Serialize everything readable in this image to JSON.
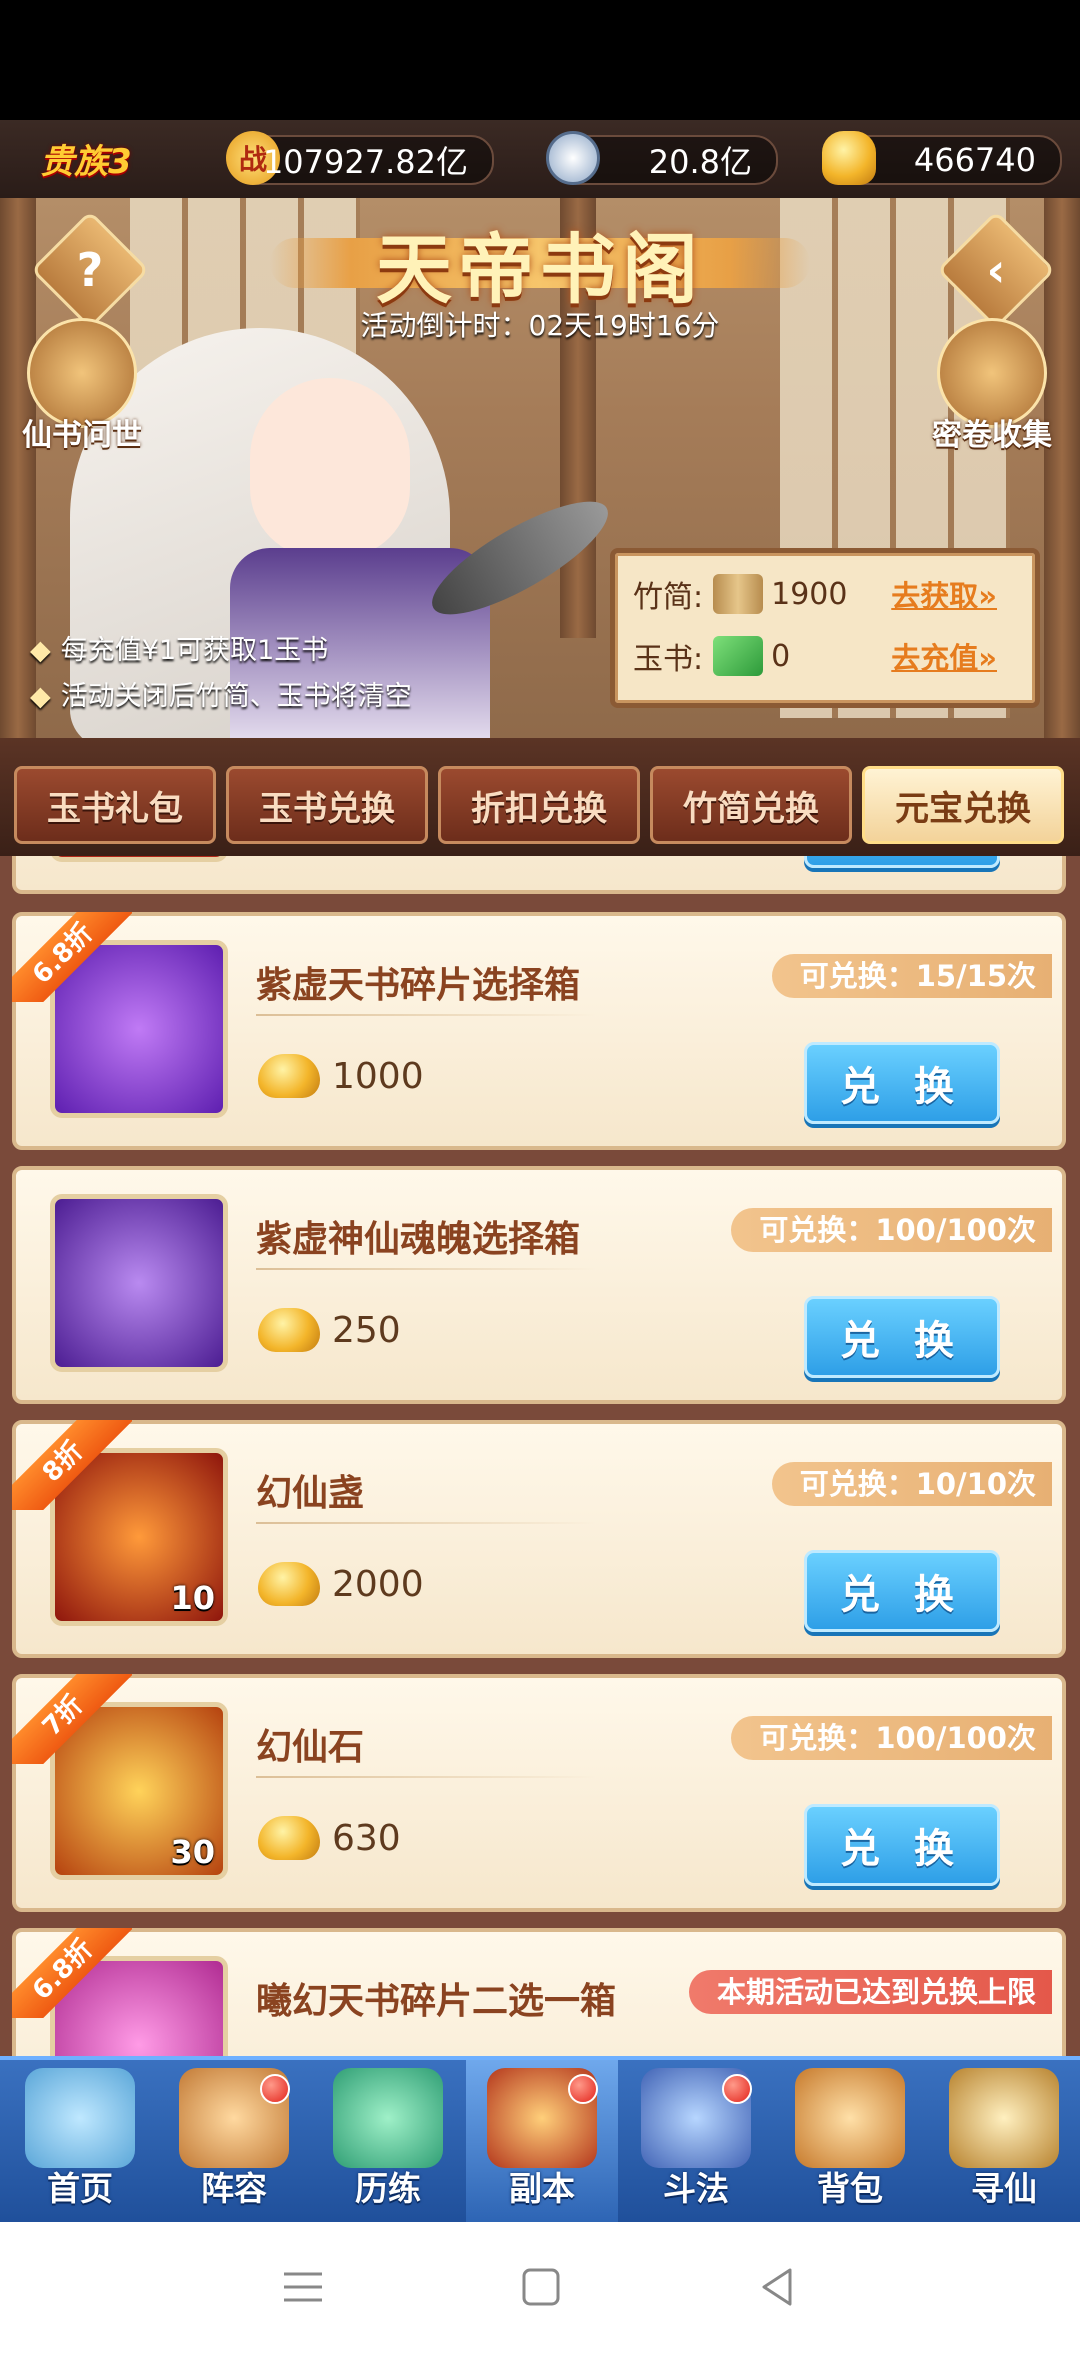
{
  "resources": {
    "vip_label": "贵族3",
    "power_icon_glyph": "战",
    "power_value": "107927.82亿",
    "silver_value": "20.8亿",
    "gold_value": "466740"
  },
  "banner": {
    "title": "天帝书阁",
    "countdown": "活动倒计时：02天19时16分",
    "left_button_label": "仙书问世",
    "right_button_label": "密卷收集",
    "help_glyph": "?",
    "back_glyph": "‹",
    "notes": [
      "每充值¥1可获取1玉书",
      "活动关闭后竹简、玉书将清空"
    ],
    "currency": [
      {
        "label": "竹简:",
        "value": "1900",
        "link": "去获取»",
        "icon": "bamboo-scroll-icon"
      },
      {
        "label": "玉书:",
        "value": "0",
        "link": "去充值»",
        "icon": "jade-book-icon"
      }
    ]
  },
  "tabs": [
    "玉书礼包",
    "玉书兑换",
    "折扣兑换",
    "竹简兑换",
    "元宝兑换"
  ],
  "active_tab_index": 4,
  "items": [
    {
      "name": "紫虚天书碎片选择箱",
      "price": "1000",
      "limit": "可兑换：15/15次",
      "discount": "6.8折",
      "qty": "",
      "button": "兑 换",
      "color": "#7b3fd6"
    },
    {
      "name": "紫虚神仙魂魄选择箱",
      "price": "250",
      "limit": "可兑换：100/100次",
      "discount": "",
      "qty": "",
      "button": "兑 换",
      "color": "#6a34c2"
    },
    {
      "name": "幻仙盏",
      "price": "2000",
      "limit": "可兑换：10/10次",
      "discount": "8折",
      "qty": "10",
      "button": "兑 换",
      "color": "#c9301c"
    },
    {
      "name": "幻仙石",
      "price": "630",
      "limit": "可兑换：100/100次",
      "discount": "7折",
      "qty": "30",
      "button": "兑 换",
      "color": "#c46a1c"
    },
    {
      "name": "曦幻天书碎片二选一箱",
      "price": "",
      "limit": "本期活动已达到兑换上限",
      "discount": "6.8折",
      "qty": "",
      "button": "",
      "color": "#d548b8"
    }
  ],
  "bottom_nav": [
    {
      "label": "首页",
      "dot": false
    },
    {
      "label": "阵容",
      "dot": true
    },
    {
      "label": "历练",
      "dot": false
    },
    {
      "label": "副本",
      "dot": true
    },
    {
      "label": "斗法",
      "dot": true
    },
    {
      "label": "背包",
      "dot": false
    },
    {
      "label": "寻仙",
      "dot": false
    }
  ]
}
